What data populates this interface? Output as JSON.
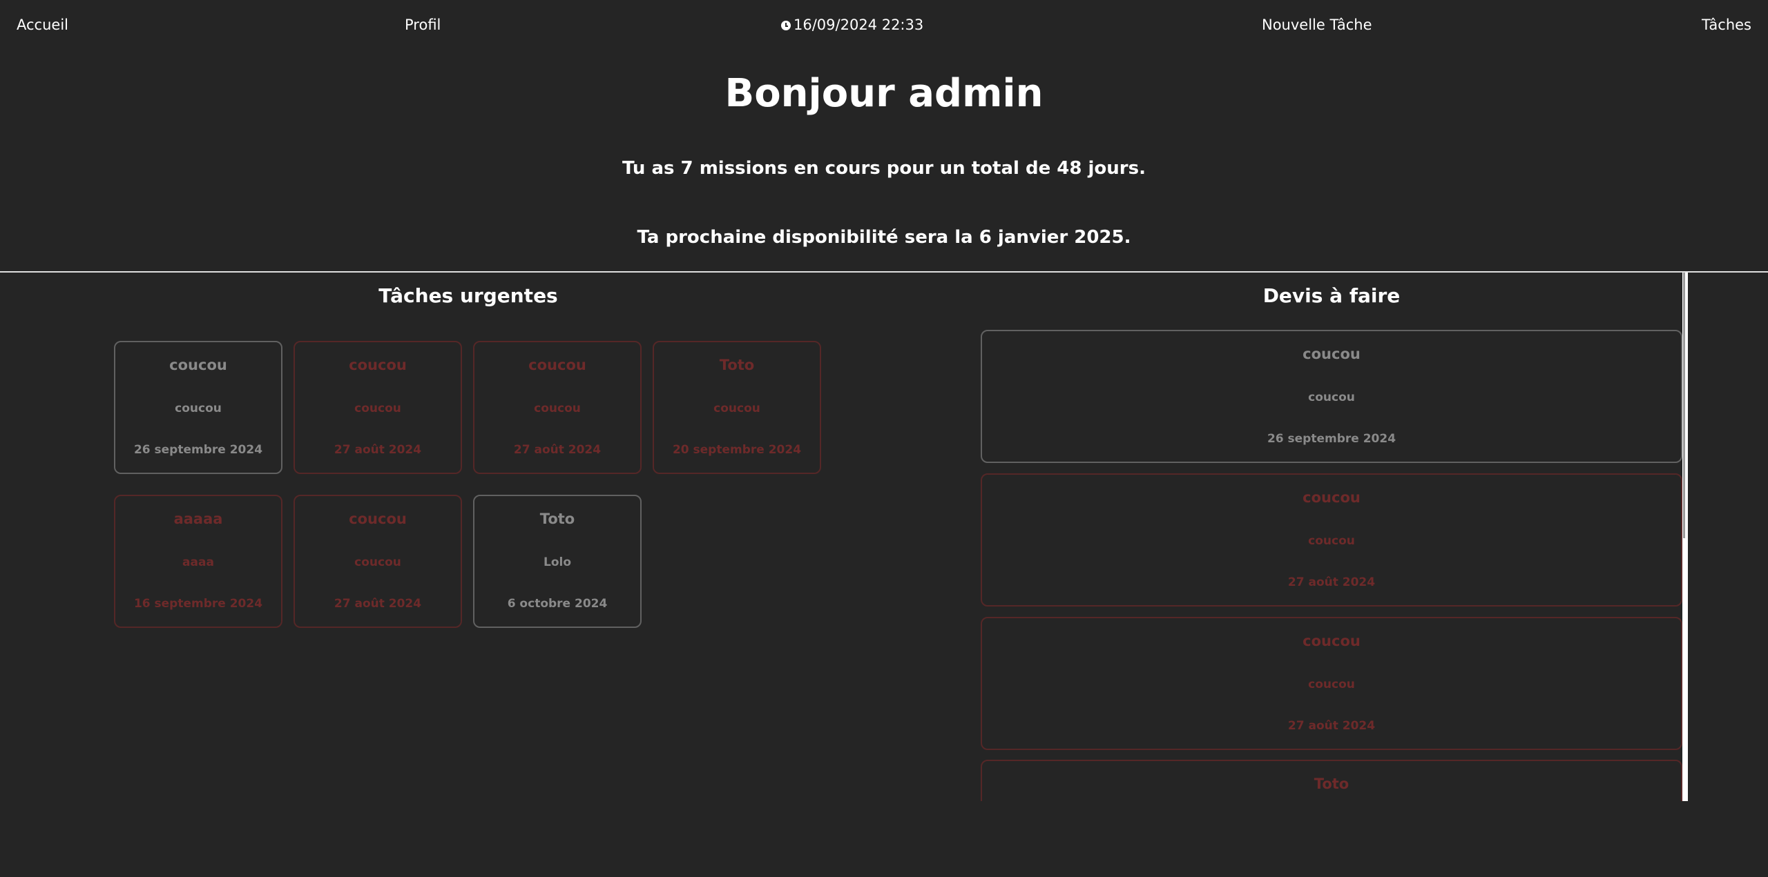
{
  "nav": {
    "home": "Accueil",
    "profile": "Profil",
    "datetime": "16/09/2024 22:33",
    "new_task": "Nouvelle Tâche",
    "tasks": "Tâches"
  },
  "greeting": "Bonjour admin",
  "summary_missions": "Tu as 7 missions en cours pour un total de 48 jours.",
  "summary_availability": "Ta prochaine disponibilité sera la 6 janvier 2025.",
  "urgent": {
    "title": "Tâches urgentes",
    "cards": [
      {
        "title": "coucou",
        "desc": "coucou",
        "date": "26 septembre 2024",
        "overdue": false
      },
      {
        "title": "coucou",
        "desc": "coucou",
        "date": "27 août 2024",
        "overdue": true
      },
      {
        "title": "coucou",
        "desc": "coucou",
        "date": "27 août 2024",
        "overdue": true
      },
      {
        "title": "Toto",
        "desc": "coucou",
        "date": "20 septembre 2024",
        "overdue": true
      },
      {
        "title": "aaaaa",
        "desc": "aaaa",
        "date": "16 septembre 2024",
        "overdue": true
      },
      {
        "title": "coucou",
        "desc": "coucou",
        "date": "27 août 2024",
        "overdue": true
      },
      {
        "title": "Toto",
        "desc": "Lolo",
        "date": "6 octobre 2024",
        "overdue": false
      }
    ]
  },
  "quotes": {
    "title": "Devis à faire",
    "cards": [
      {
        "title": "coucou",
        "desc": "coucou",
        "date": "26 septembre 2024",
        "overdue": false
      },
      {
        "title": "coucou",
        "desc": "coucou",
        "date": "27 août 2024",
        "overdue": true
      },
      {
        "title": "coucou",
        "desc": "coucou",
        "date": "27 août 2024",
        "overdue": true
      },
      {
        "title": "Toto",
        "desc": "",
        "date": "",
        "overdue": true
      }
    ]
  },
  "colors": {
    "background": "#252525",
    "text": "#ffffff",
    "card_normal": "#8a8a8a",
    "card_overdue": "#6e2a2a"
  }
}
